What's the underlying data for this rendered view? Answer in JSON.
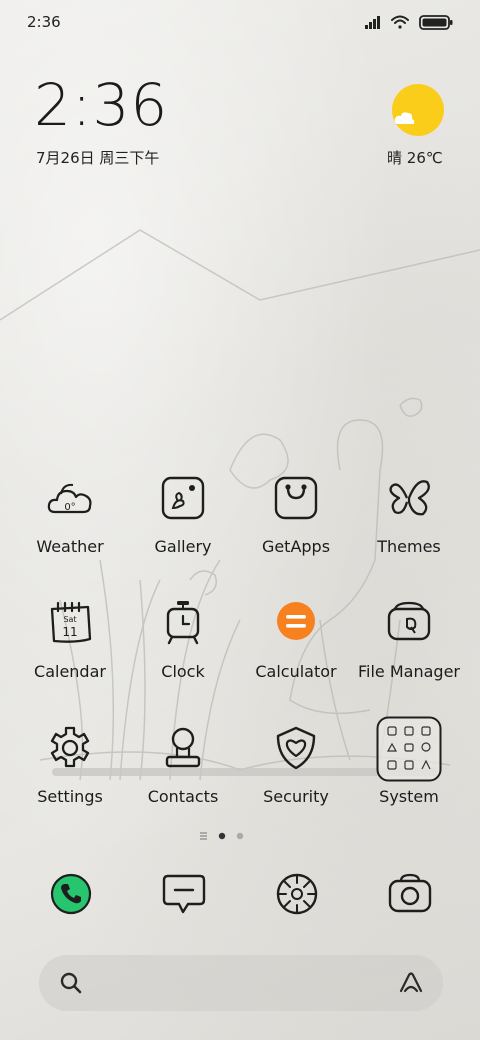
{
  "status_bar": {
    "time": "2:36"
  },
  "clock_widget": {
    "time": "2:36",
    "date": "7月26日 周三下午"
  },
  "weather_widget": {
    "condition": "晴",
    "temperature": "26℃",
    "icon": "sun-cloud-icon"
  },
  "apps": [
    {
      "label": "Weather",
      "icon": "weather-cloud-icon",
      "badge": "0°"
    },
    {
      "label": "Gallery",
      "icon": "gallery-icon"
    },
    {
      "label": "GetApps",
      "icon": "getapps-bag-icon"
    },
    {
      "label": "Themes",
      "icon": "butterfly-icon"
    },
    {
      "label": "Calendar",
      "icon": "calendar-icon",
      "day_name": "Sat",
      "day_num": "11"
    },
    {
      "label": "Clock",
      "icon": "alarm-clock-icon"
    },
    {
      "label": "Calculator",
      "icon": "calculator-icon"
    },
    {
      "label": "File Manager",
      "icon": "folder-icon"
    },
    {
      "label": "Settings",
      "icon": "gear-icon"
    },
    {
      "label": "Contacts",
      "icon": "contacts-person-icon"
    },
    {
      "label": "Security",
      "icon": "shield-heart-icon"
    },
    {
      "label": "System",
      "icon": "folder-grid-icon"
    }
  ],
  "page_indicator": {
    "pages": 2,
    "current": 1
  },
  "dock": [
    {
      "icon": "phone-icon"
    },
    {
      "icon": "messages-icon"
    },
    {
      "icon": "browser-icon"
    },
    {
      "icon": "camera-icon"
    }
  ],
  "search_bar": {
    "left_icon": "search-icon",
    "right_icon": "assistant-icon"
  },
  "colors": {
    "sun": "#fbcd1b",
    "calculator": "#f7801f",
    "phone": "#27c56e",
    "ink": "#1e1e1e"
  }
}
